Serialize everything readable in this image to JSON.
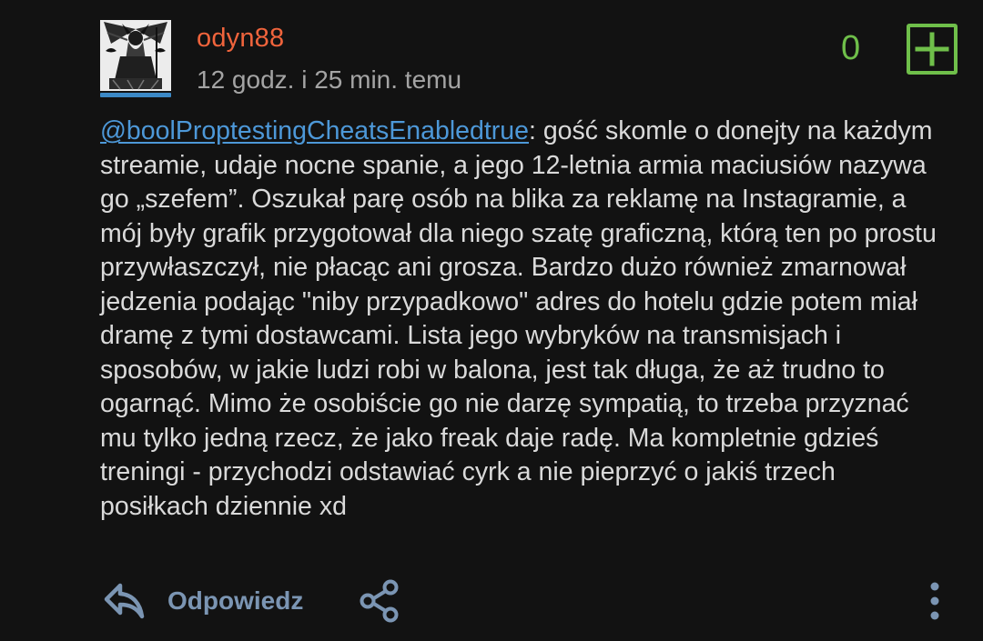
{
  "comment": {
    "username": "odyn88",
    "timestamp": "12 godz. i 25 min. temu",
    "score": "0",
    "mention": "@boolProptestingCheatsEnabledtrue",
    "text": ": gość skomle o donejty na każdym streamie, udaje nocne spanie, a jego 12-letnia armia maciusiów nazywa go „szefem”. Oszukał parę osób na blika za reklamę na Instagramie, a mój były grafik przygotował dla niego szatę graficzną, którą ten po prostu przywłaszczył, nie płacąc ani grosza. Bardzo dużo również zmarnował jedzenia podając \"niby przypadkowo\" adres do hotelu gdzie potem miał dramę z tymi dostawcami. Lista jego wybryków na transmisjach i sposobów, w jakie ludzi robi w balona, jest tak długa, że aż trudno to ogarnąć. Mimo że osobiście go nie darzę sympatią, to trzeba przyznać mu tylko jedną rzecz, że jako freak daje radę. Ma kompletnie gdzieś treningi - przychodzi odstawiać cyrk a nie pieprzyć o jakiś trzech posiłkach dziennie xd"
  },
  "actions": {
    "reply_label": "Odpowiedz",
    "reply_icon": "reply-icon",
    "share_icon": "share-icon",
    "more_icon": "more-vertical-icon",
    "plus_icon": "plus-icon"
  },
  "colors": {
    "background": "#121212",
    "username": "#f0643c",
    "link": "#4d98d8",
    "score": "#6fbf4a",
    "action": "#7b95b3",
    "avatar_underline": "#3c89c6"
  }
}
